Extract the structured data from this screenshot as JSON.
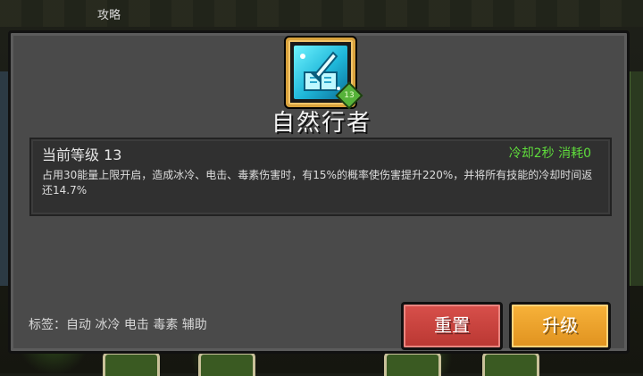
{
  "header": {
    "label": "攻略"
  },
  "skill": {
    "name": "自然行者",
    "icon": "crystal-book-sword-icon",
    "badge": "13",
    "level_label": "当前等级 13",
    "cooldown_cost": "冷却2秒 消耗0",
    "description": "占用30能量上限开启，造成冰冷、电击、毒素伤害时，有15%的概率使伤害提升220%，并将所有技能的冷却时间返还14.7%",
    "tags": "标签：自动 冰冷 电击 毒素 辅助"
  },
  "buttons": {
    "reset": "重置",
    "upgrade": "升级"
  },
  "colors": {
    "panel": "#4a4a4a",
    "frame": "#d9a23c",
    "accent_green": "#5fdc3c",
    "reset_red": "#c8423d",
    "upgrade_orange": "#eea12c"
  }
}
